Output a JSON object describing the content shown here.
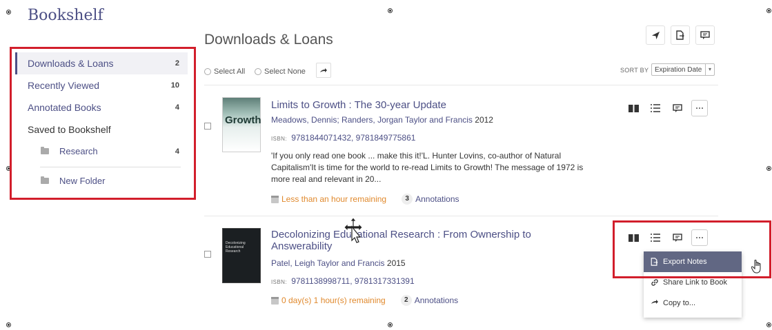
{
  "app": {
    "title": "Bookshelf"
  },
  "sidebar": {
    "items": [
      {
        "label": "Downloads & Loans",
        "count": "2"
      },
      {
        "label": "Recently Viewed",
        "count": "10"
      },
      {
        "label": "Annotated Books",
        "count": "4"
      },
      {
        "label": "Saved to Bookshelf",
        "count": ""
      },
      {
        "label": "Research",
        "count": "4"
      },
      {
        "label": "New Folder",
        "count": ""
      }
    ]
  },
  "main": {
    "title": "Downloads & Loans",
    "toolbar": {
      "select_all": "Select All",
      "select_none": "Select None",
      "sort_label": "SORT BY",
      "sort_value": "Expiration Date"
    },
    "books": [
      {
        "title": "Limits to Growth : The 30-year Update",
        "authors": "Meadows, Dennis; Randers, Jorgan",
        "publisher": "Taylor and Francis",
        "year": "2012",
        "isbn_label": "ISBN:",
        "isbn": "9781844071432, 9781849775861",
        "description": "'If you only read one book ... make this it!'L. Hunter Lovins, co-author of Natural Capitalism'It is time for the world to re-read Limits to Growth! The message of 1972 is more real and relevant in 20...",
        "remaining": "Less than an hour remaining",
        "annotation_count": "3",
        "annotation_label": "Annotations",
        "cover_text": "Growth"
      },
      {
        "title": "Decolonizing Educational Research : From Ownership to Answerability",
        "authors": "Patel, Leigh",
        "publisher": "Taylor and Francis",
        "year": "2015",
        "isbn_label": "ISBN:",
        "isbn": "9781138998711, 9781317331391",
        "description": "",
        "remaining": "0 day(s) 1 hour(s) remaining",
        "annotation_count": "2",
        "annotation_label": "Annotations",
        "cover_text": "Decolonizing Educational Research"
      }
    ]
  },
  "dropdown": {
    "items": [
      {
        "label": "Export Notes"
      },
      {
        "label": "Share Link to Book"
      },
      {
        "label": "Copy to..."
      }
    ]
  },
  "colors": {
    "brand": "#4c4f85",
    "highlight_box": "#d21e2b",
    "remaining": "#e0892d",
    "menu_highlight": "#616783"
  },
  "icons": [
    "send-icon",
    "export-file-icon",
    "comment-icon",
    "book-icon",
    "list-icon",
    "more-icon",
    "folder-icon",
    "link-icon",
    "copy-arrow-icon",
    "calendar-icon",
    "move-cursor-icon",
    "hand-cursor-icon"
  ]
}
